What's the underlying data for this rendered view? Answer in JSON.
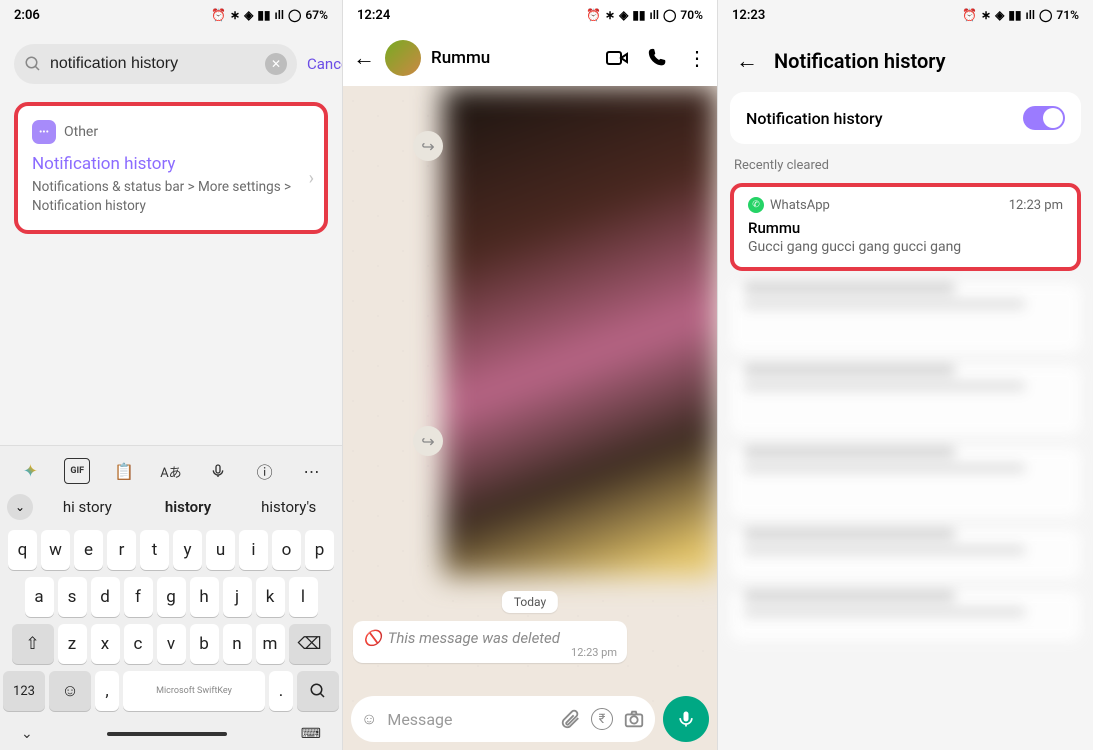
{
  "phone1": {
    "status": {
      "time": "2:06",
      "battery": "67%"
    },
    "search": {
      "value": "notification history",
      "cancel": "Cancel"
    },
    "result": {
      "category": "Other",
      "title": "Notification history",
      "path": "Notifications & status bar > More settings > Notification history"
    },
    "keyboard": {
      "suggestions": [
        "hi story",
        "history",
        "history's"
      ],
      "row1": [
        "q",
        "w",
        "e",
        "r",
        "t",
        "y",
        "u",
        "i",
        "o",
        "p"
      ],
      "row2": [
        "a",
        "s",
        "d",
        "f",
        "g",
        "h",
        "j",
        "k",
        "l"
      ],
      "row3": [
        "z",
        "x",
        "c",
        "v",
        "b",
        "n",
        "m"
      ],
      "numKey": "123",
      "spaceLabel": "Microsoft SwiftKey"
    }
  },
  "phone2": {
    "status": {
      "time": "12:24",
      "battery": "70%"
    },
    "chat": {
      "name": "Rummu",
      "dateLabel": "Today",
      "deletedText": "This message was deleted",
      "deletedTime": "12:23 pm",
      "placeholder": "Message"
    }
  },
  "phone3": {
    "status": {
      "time": "12:23",
      "battery": "71%"
    },
    "title": "Notification history",
    "toggleCard": {
      "label": "Notification history"
    },
    "sectionLabel": "Recently cleared",
    "notif": {
      "app": "WhatsApp",
      "time": "12:23 pm",
      "title": "Rummu",
      "body": "Gucci gang gucci gang gucci gang"
    }
  }
}
